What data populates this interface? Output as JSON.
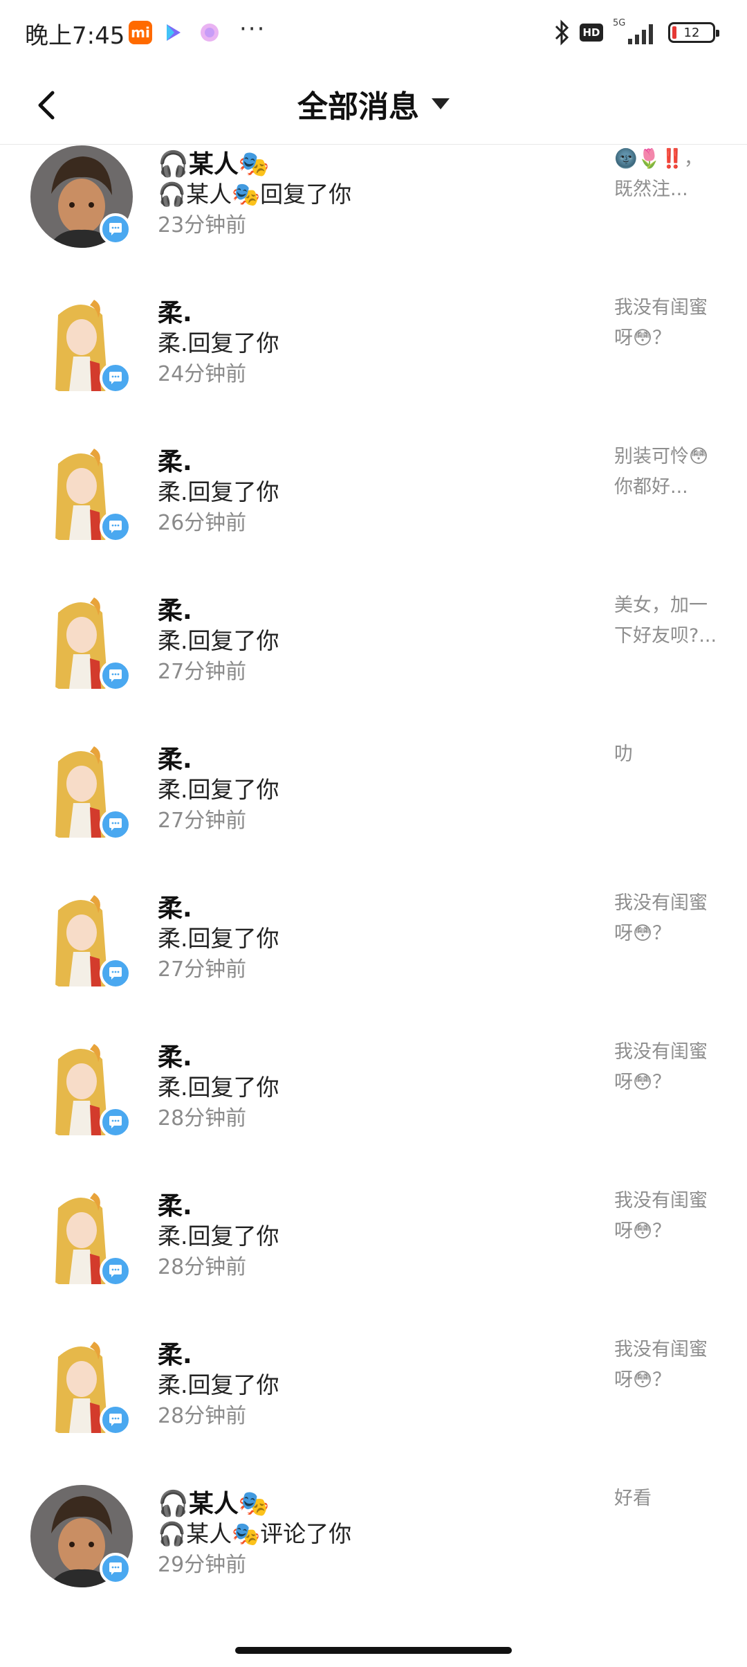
{
  "status_bar": {
    "time": "晚上7:45",
    "mi_label": "mi",
    "more": "···",
    "hd": "HD",
    "network": "5G",
    "battery": "12"
  },
  "header": {
    "title": "全部消息"
  },
  "messages": [
    {
      "name": "🎧某人🎭",
      "action": "🎧某人🎭回复了你",
      "time": "23分钟前",
      "preview_l1": "🌚🌷‼️，",
      "preview_l2": "既然注...",
      "avatar": "boy"
    },
    {
      "name": "柔.",
      "action": "柔.回复了你",
      "time": "24分钟前",
      "preview_l1": "我没有闺蜜",
      "preview_l2": "呀😳？",
      "avatar": "girl"
    },
    {
      "name": "柔.",
      "action": "柔.回复了你",
      "time": "26分钟前",
      "preview_l1": "别装可怜😳",
      "preview_l2": "你都好...",
      "avatar": "girl"
    },
    {
      "name": "柔.",
      "action": "柔.回复了你",
      "time": "27分钟前",
      "preview_l1": "美女，加一",
      "preview_l2": "下好友呗?...",
      "avatar": "girl"
    },
    {
      "name": "柔.",
      "action": "柔.回复了你",
      "time": "27分钟前",
      "preview_l1": "叻",
      "preview_l2": "",
      "avatar": "girl"
    },
    {
      "name": "柔.",
      "action": "柔.回复了你",
      "time": "27分钟前",
      "preview_l1": "我没有闺蜜",
      "preview_l2": "呀😳？",
      "avatar": "girl"
    },
    {
      "name": "柔.",
      "action": "柔.回复了你",
      "time": "28分钟前",
      "preview_l1": "我没有闺蜜",
      "preview_l2": "呀😳？",
      "avatar": "girl"
    },
    {
      "name": "柔.",
      "action": "柔.回复了你",
      "time": "28分钟前",
      "preview_l1": "我没有闺蜜",
      "preview_l2": "呀😳？",
      "avatar": "girl"
    },
    {
      "name": "柔.",
      "action": "柔.回复了你",
      "time": "28分钟前",
      "preview_l1": "我没有闺蜜",
      "preview_l2": "呀😳？",
      "avatar": "girl"
    },
    {
      "name": "🎧某人🎭",
      "action": "🎧某人🎭评论了你",
      "time": "29分钟前",
      "preview_l1": "好看",
      "preview_l2": "",
      "avatar": "boy"
    }
  ],
  "colors": {
    "badge": "#4aa8f0",
    "time_text": "#8a8a8a",
    "preview_text": "#8e8e8e"
  }
}
